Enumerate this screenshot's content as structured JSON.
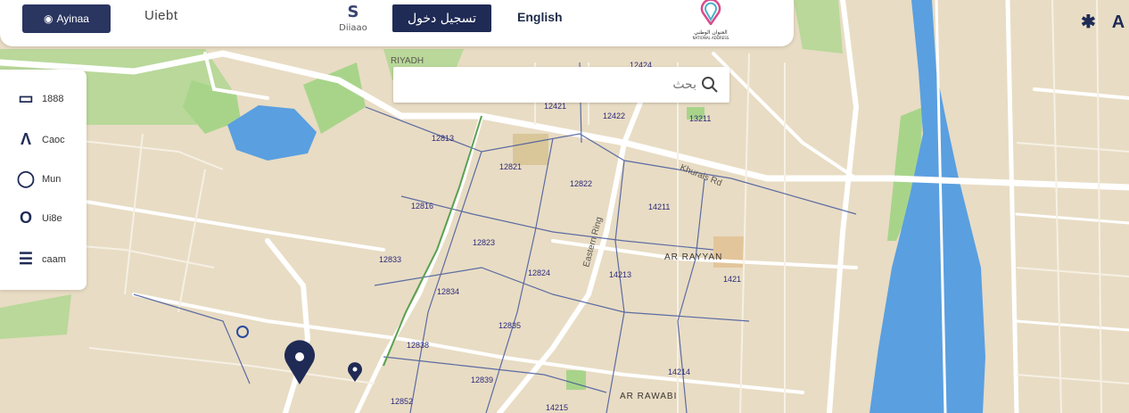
{
  "header": {
    "brand_label": "Ayinaa",
    "nav_link": "Uiebt",
    "menu_label": "Diiaao",
    "login_label": "تسجيل دخول",
    "language_label": "English",
    "logo_text_ar": "العنوان الوطني",
    "logo_text_en": "NATIONAL ADDRESS"
  },
  "search": {
    "placeholder": "بحث"
  },
  "side_panel": {
    "items": [
      {
        "icon": "layers-icon",
        "label": "1888"
      },
      {
        "icon": "triangle-icon",
        "label": "Caoc"
      },
      {
        "icon": "circle-icon",
        "label": "Mun"
      },
      {
        "icon": "oval-icon",
        "label": "Ui8e"
      },
      {
        "icon": "list-icon",
        "label": "caam"
      }
    ]
  },
  "map": {
    "city": "RIYADH",
    "districts": [
      "AR RAYYAN",
      "AR RAWABI"
    ],
    "roads": [
      "Khurais Rd",
      "Eastern Ring"
    ],
    "zip_codes": [
      "12424",
      "12421",
      "12422",
      "13211",
      "12813",
      "12821",
      "12822",
      "12816",
      "14211",
      "12823",
      "12833",
      "12824",
      "14213",
      "12834",
      "12835",
      "12838",
      "12839",
      "12852",
      "14214",
      "14215",
      "1421"
    ]
  },
  "colors": {
    "navy": "#1f2b55",
    "water": "#5a9fe0",
    "park": "#a8d48a",
    "land": "#e8dcc4"
  }
}
